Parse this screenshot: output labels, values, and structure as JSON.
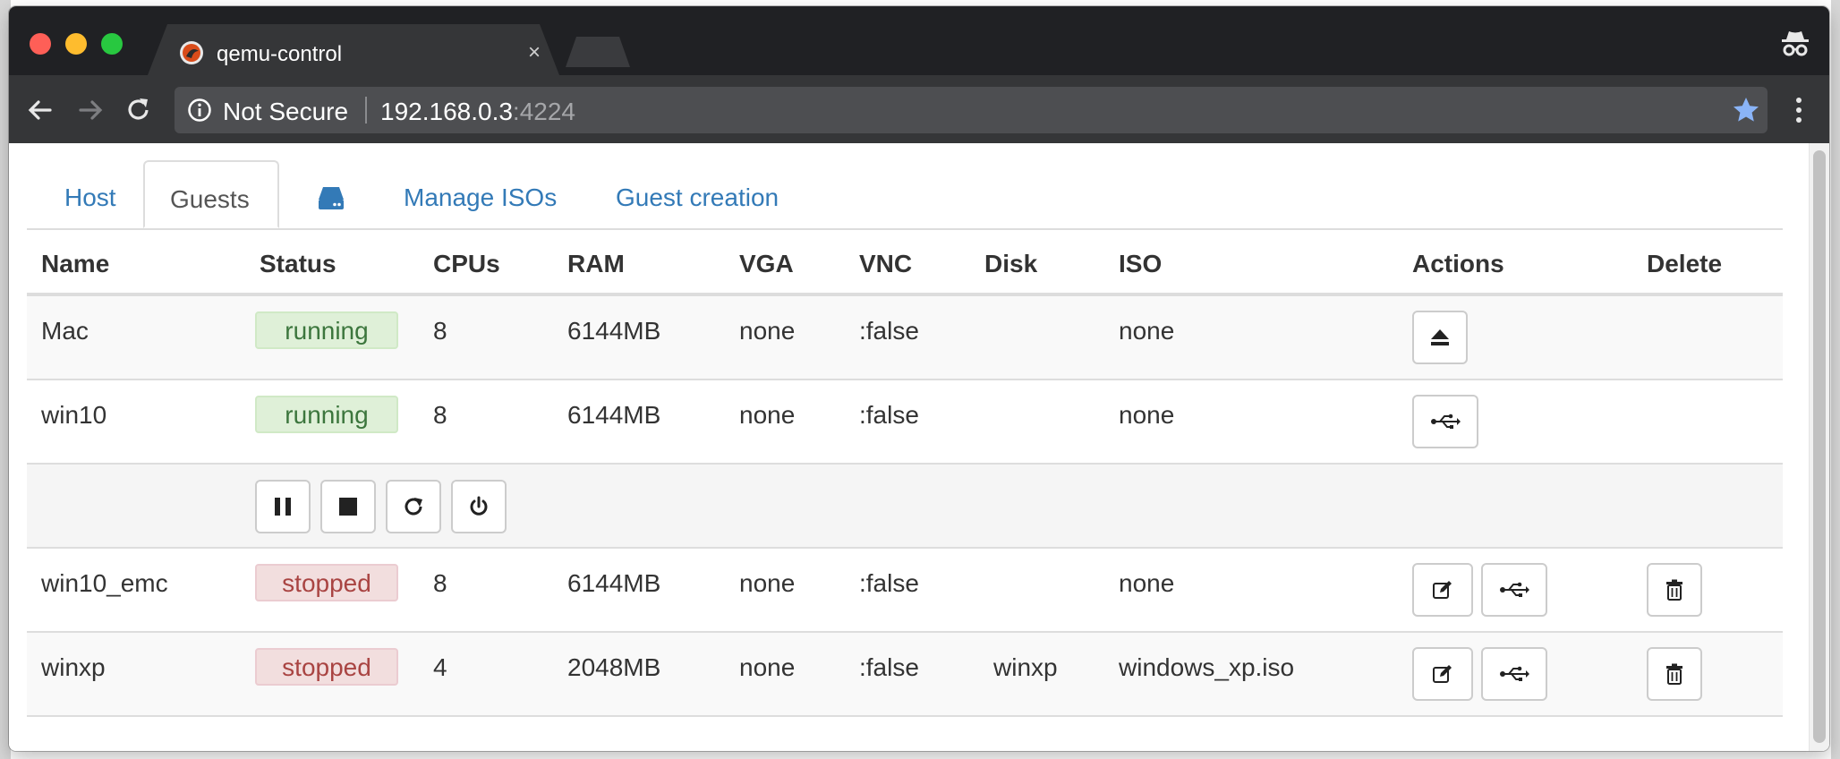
{
  "browser": {
    "tab_title": "qemu-control",
    "security_label": "Not Secure",
    "url_host": "192.168.0.3",
    "url_port": ":4224",
    "tab_close_glyph": "×",
    "icons": [
      "back-arrow-icon",
      "forward-arrow-icon",
      "reload-icon",
      "info-icon",
      "bookmark-star-icon",
      "menu-dots-icon",
      "incognito-icon",
      "qemu-favicon-icon"
    ],
    "colors": {
      "frame": "#202124",
      "toolbar": "#353638",
      "omnibox": "#4d4e51",
      "star": "#8ab4f8"
    }
  },
  "nav": {
    "tabs": [
      {
        "label": "Host"
      },
      {
        "label": "Guests",
        "active": true
      },
      {
        "label": "",
        "icon": "hdd-icon"
      },
      {
        "label": "Manage ISOs"
      },
      {
        "label": "Guest creation"
      }
    ],
    "link_color": "#337ab7"
  },
  "table": {
    "headers": [
      "Name",
      "Status",
      "CPUs",
      "RAM",
      "VGA",
      "VNC",
      "Disk",
      "ISO",
      "Actions",
      "Delete"
    ],
    "rows": [
      {
        "name": "Mac",
        "status": "running",
        "cpus": "8",
        "ram": "6144MB",
        "vga": "none",
        "vnc": ":false",
        "disk": "",
        "iso": "none",
        "actions": [
          "eject-icon"
        ],
        "delete": false
      },
      {
        "name": "win10",
        "status": "running",
        "cpus": "8",
        "ram": "6144MB",
        "vga": "none",
        "vnc": ":false",
        "disk": "",
        "iso": "none",
        "actions": [
          "usb-icon"
        ],
        "delete": false
      },
      {
        "name": "win10_emc",
        "status": "stopped",
        "cpus": "8",
        "ram": "6144MB",
        "vga": "none",
        "vnc": ":false",
        "disk": "",
        "iso": "none",
        "actions": [
          "edit-icon",
          "usb-icon"
        ],
        "delete": true
      },
      {
        "name": "winxp",
        "status": "stopped",
        "cpus": "4",
        "ram": "2048MB",
        "vga": "none",
        "vnc": ":false",
        "disk": "winxp",
        "iso": "windows_xp.iso",
        "actions": [
          "edit-icon",
          "usb-icon"
        ],
        "delete": true
      }
    ],
    "control_row_buttons": [
      "pause-icon",
      "stop-icon",
      "restart-icon",
      "power-icon"
    ],
    "status_colors": {
      "running": "#3c763d",
      "stopped": "#a94442"
    }
  }
}
